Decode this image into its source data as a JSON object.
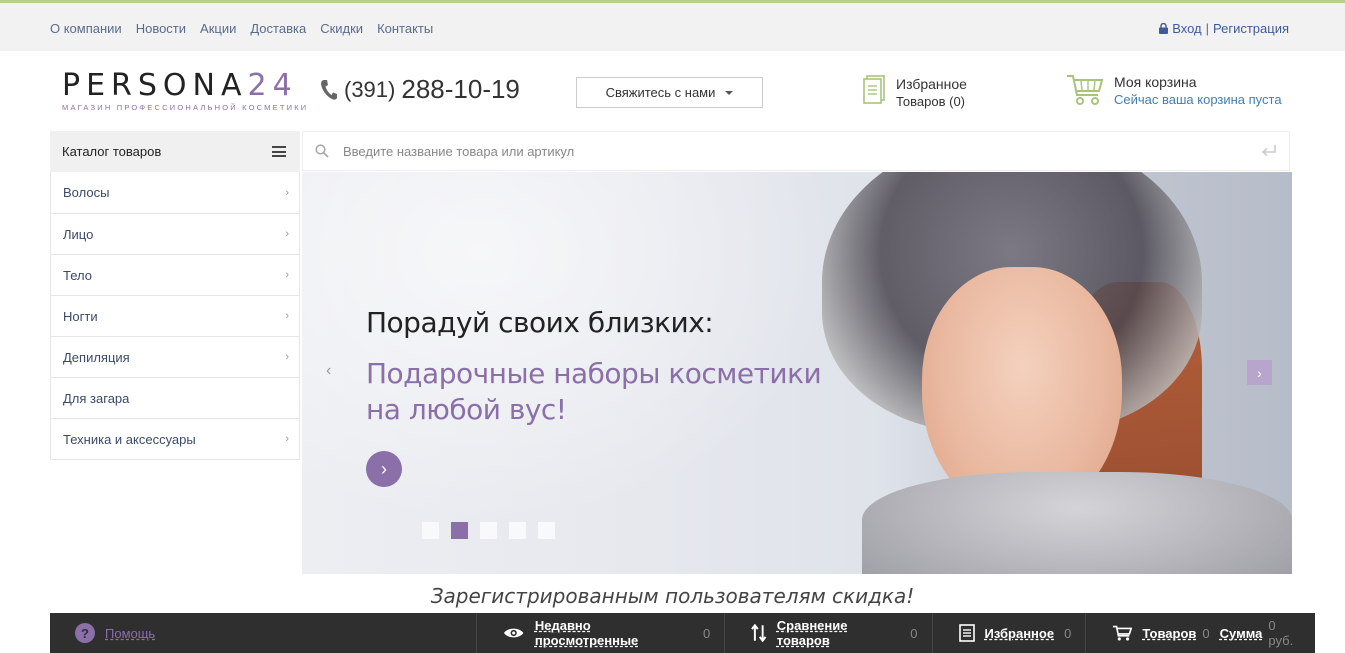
{
  "topnav": {
    "links": [
      "О компании",
      "Новости",
      "Акции",
      "Доставка",
      "Скидки",
      "Контакты"
    ],
    "login": "Вход",
    "separator": "|",
    "register": "Регистрация"
  },
  "header": {
    "logo_main": "PERSONA",
    "logo_num": "24",
    "logo_sub": "МАГАЗИН ПРОФЕССИОНАЛЬНОЙ КОСМЕТИКИ",
    "phone_code": "(391)",
    "phone_number": "288-10-19",
    "contact_button": "Свяжитесь с нами",
    "favorites_title": "Избранное",
    "favorites_count": "Товаров (0)",
    "cart_title": "Моя корзина",
    "cart_status": "Сейчас ваша корзина пуста"
  },
  "catalog": {
    "title": "Каталог товаров",
    "items": [
      {
        "label": "Волосы",
        "chevron": "›"
      },
      {
        "label": "Лицо",
        "chevron": "›"
      },
      {
        "label": "Тело",
        "chevron": "›"
      },
      {
        "label": "Ногти",
        "chevron": "›"
      },
      {
        "label": "Депиляция",
        "chevron": "›"
      },
      {
        "label": "Для загара",
        "chevron": ""
      },
      {
        "label": "Техника и аксессуары",
        "chevron": "›"
      }
    ]
  },
  "search": {
    "placeholder": "Введите название товара или артикул"
  },
  "banner": {
    "title": "Порадуй своих близких:",
    "subtitle": "Подарочные наборы косметики на любой вуc!",
    "active_slide": 2,
    "slide_count": 5
  },
  "promo": {
    "text": "Зарегистрированным пользователям скидка!"
  },
  "footer": {
    "help": "Помощь",
    "recent": "Недавно просмотренные",
    "recent_count": "0",
    "compare": "Сравнение товаров",
    "compare_count": "0",
    "favorites": "Избранное",
    "favorites_count": "0",
    "goods": "Товаров",
    "goods_count": "0",
    "sum": "Сумма",
    "sum_value": "0 руб."
  },
  "colors": {
    "accent": "#8a6fa8",
    "top_line": "#b5cf8e",
    "footer_bg": "#2f2f2f",
    "icon_green": "#a8c47a"
  }
}
